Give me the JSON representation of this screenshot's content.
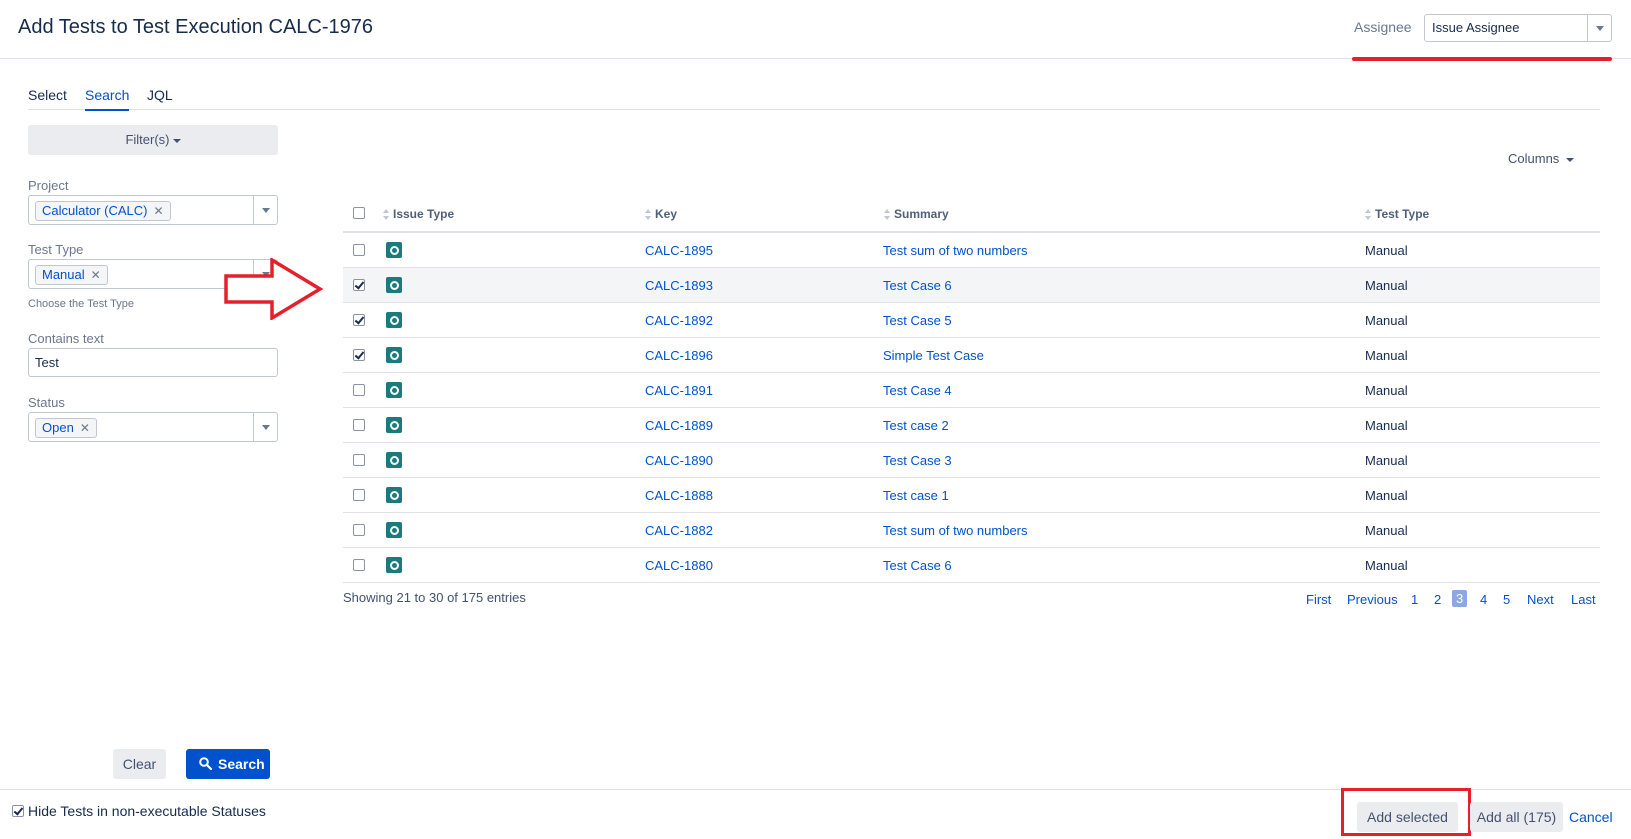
{
  "header": {
    "title": "Add Tests to Test Execution CALC-1976",
    "assignee_label": "Assignee",
    "assignee_value": "Issue Assignee"
  },
  "tabs": [
    {
      "label": "Select",
      "active": false
    },
    {
      "label": "Search",
      "active": true
    },
    {
      "label": "JQL",
      "active": false
    }
  ],
  "filters": {
    "button_label": "Filter(s)",
    "project": {
      "label": "Project",
      "chip": "Calculator (CALC)"
    },
    "test_type": {
      "label": "Test Type",
      "chip": "Manual",
      "help": "Choose the Test Type"
    },
    "contains_text": {
      "label": "Contains text",
      "value": "Test"
    },
    "status": {
      "label": "Status",
      "chip": "Open"
    }
  },
  "table": {
    "columns_button": "Columns",
    "headers": {
      "issue_type": "Issue Type",
      "key": "Key",
      "summary": "Summary",
      "test_type": "Test Type"
    },
    "rows": [
      {
        "key": "CALC-1895",
        "summary": "Test sum of two numbers",
        "test_type": "Manual",
        "checked": false
      },
      {
        "key": "CALC-1893",
        "summary": "Test Case 6",
        "test_type": "Manual",
        "checked": true
      },
      {
        "key": "CALC-1892",
        "summary": "Test Case 5",
        "test_type": "Manual",
        "checked": true
      },
      {
        "key": "CALC-1896",
        "summary": "Simple Test Case",
        "test_type": "Manual",
        "checked": true
      },
      {
        "key": "CALC-1891",
        "summary": "Test Case 4",
        "test_type": "Manual",
        "checked": false
      },
      {
        "key": "CALC-1889",
        "summary": "Test case 2",
        "test_type": "Manual",
        "checked": false
      },
      {
        "key": "CALC-1890",
        "summary": "Test Case 3",
        "test_type": "Manual",
        "checked": false
      },
      {
        "key": "CALC-1888",
        "summary": "Test case 1",
        "test_type": "Manual",
        "checked": false
      },
      {
        "key": "CALC-1882",
        "summary": "Test sum of two numbers",
        "test_type": "Manual",
        "checked": false
      },
      {
        "key": "CALC-1880",
        "summary": "Test Case 6",
        "test_type": "Manual",
        "checked": false
      }
    ],
    "showing": "Showing 21 to 30 of 175 entries"
  },
  "pagination": {
    "first": "First",
    "previous": "Previous",
    "pages": [
      "1",
      "2",
      "3",
      "4",
      "5"
    ],
    "current": "3",
    "next": "Next",
    "last": "Last"
  },
  "actions": {
    "clear": "Clear",
    "search": "Search",
    "hide_label": "Hide Tests in non-executable Statuses",
    "hide_checked": true,
    "add_selected": "Add selected",
    "add_all": "Add all (175)",
    "cancel": "Cancel"
  },
  "colors": {
    "accent": "#0052cc",
    "annotation_red": "#e5202a",
    "test_icon": "#1b7a7e",
    "current_page": "#8ba8e3"
  },
  "icons": {
    "issue_type": "test-issue-icon",
    "search": "search-icon",
    "sort": "sort-icon",
    "dropdown": "chevron-down-icon",
    "annotation": "red-arrow-icon"
  }
}
